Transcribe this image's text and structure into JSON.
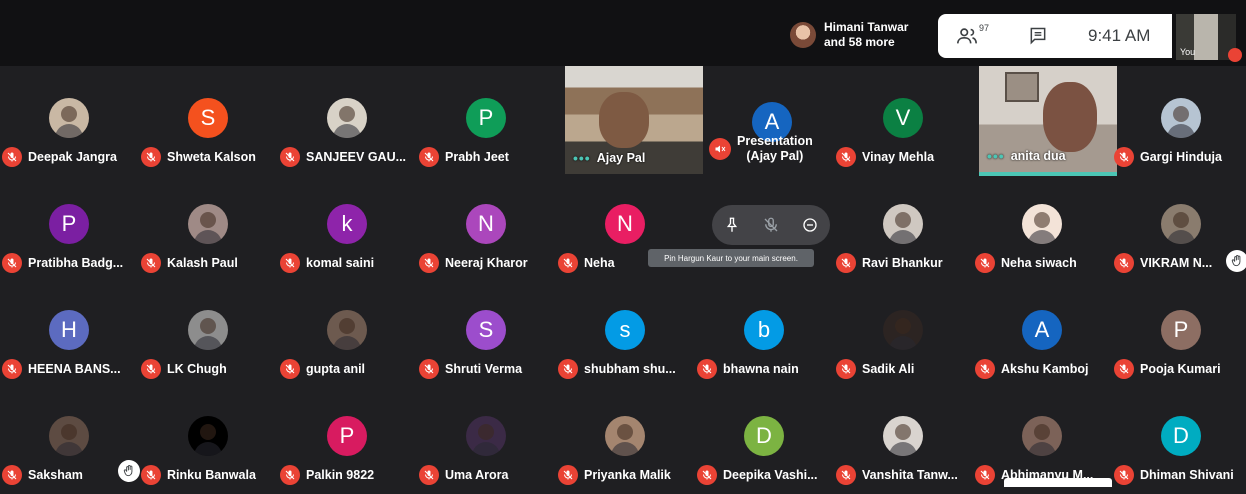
{
  "header": {
    "joined_name": "Himani Tanwar",
    "joined_more": "and 58 more",
    "people_count": "97",
    "time": "9:41 AM",
    "self_label": "You"
  },
  "participants": [
    {
      "name": "Deepak Jangra",
      "initial": "",
      "color": "#c9b8a4"
    },
    {
      "name": "Shweta Kalson",
      "initial": "S",
      "color": "#f4511e"
    },
    {
      "name": "SANJEEV GAU...",
      "initial": "",
      "color": "#d8d2c7"
    },
    {
      "name": "Prabh Jeet",
      "initial": "P",
      "color": "#0f9d58"
    },
    {
      "name": "Vinay Mehla",
      "initial": "V",
      "color": "#0b8043"
    },
    {
      "name": "Gargi Hinduja",
      "initial": "",
      "color": "#b6c4d2"
    },
    {
      "name": "Pratibha Badg...",
      "initial": "P",
      "color": "#7b1fa2"
    },
    {
      "name": "Kalash Paul",
      "initial": "",
      "color": "#9f8a86"
    },
    {
      "name": "komal saini",
      "initial": "k",
      "color": "#8e24aa"
    },
    {
      "name": "Neeraj Kharor",
      "initial": "N",
      "color": "#ab47bc"
    },
    {
      "name": "Neha",
      "initial": "N",
      "color": "#e91e63"
    },
    {
      "name": "Ravi Bhankur",
      "initial": "",
      "color": "#cfc8c1"
    },
    {
      "name": "Neha siwach",
      "initial": "",
      "color": "#f3e3d8"
    },
    {
      "name": "VIKRAM N...",
      "initial": "",
      "color": "#8a7c6e"
    },
    {
      "name": "HEENA BANS...",
      "initial": "H",
      "color": "#5c6bc0"
    },
    {
      "name": "LK Chugh",
      "initial": "",
      "color": "#8d8d8d"
    },
    {
      "name": "gupta anil",
      "initial": "",
      "color": "#6d5a4f"
    },
    {
      "name": "Shruti Verma",
      "initial": "S",
      "color": "#9c4dcc"
    },
    {
      "name": "shubham shu...",
      "initial": "s",
      "color": "#039be5"
    },
    {
      "name": "bhawna nain",
      "initial": "b",
      "color": "#039be5"
    },
    {
      "name": "Sadik Ali",
      "initial": "",
      "color": "#2c2422"
    },
    {
      "name": "Akshu Kamboj",
      "initial": "A",
      "color": "#1565c0"
    },
    {
      "name": "Pooja Kumari",
      "initial": "P",
      "color": "#8d6e63"
    },
    {
      "name": "Saksham",
      "initial": "",
      "color": "#5d4b42"
    },
    {
      "name": "Rinku Banwala",
      "initial": "",
      "color": "#000000"
    },
    {
      "name": "Palkin 9822",
      "initial": "P",
      "color": "#d81b60"
    },
    {
      "name": "Uma Arora",
      "initial": "",
      "color": "#3b2a46"
    },
    {
      "name": "Priyanka Malik",
      "initial": "",
      "color": "#a4856f"
    },
    {
      "name": "Deepika Vashi...",
      "initial": "D",
      "color": "#7cb342"
    },
    {
      "name": "Vanshita Tanw...",
      "initial": "",
      "color": "#d9d4cf"
    },
    {
      "name": "Abhimanyu M...",
      "initial": "",
      "color": "#7c6258"
    },
    {
      "name": "Dhiman Shivani",
      "initial": "D",
      "color": "#00acc1"
    }
  ],
  "video_tiles": {
    "ajay": "Ajay Pal",
    "anita": "anita dua"
  },
  "presentation": {
    "initial": "A",
    "line1": "Presentation",
    "line2": "(Ajay Pal)"
  },
  "hover": {
    "tooltip": "Pin Hargun Kaur to your main screen."
  },
  "colors": {
    "accent": "#4cc6b5",
    "mic_red": "#ea4335",
    "background": "#1f1f22"
  }
}
